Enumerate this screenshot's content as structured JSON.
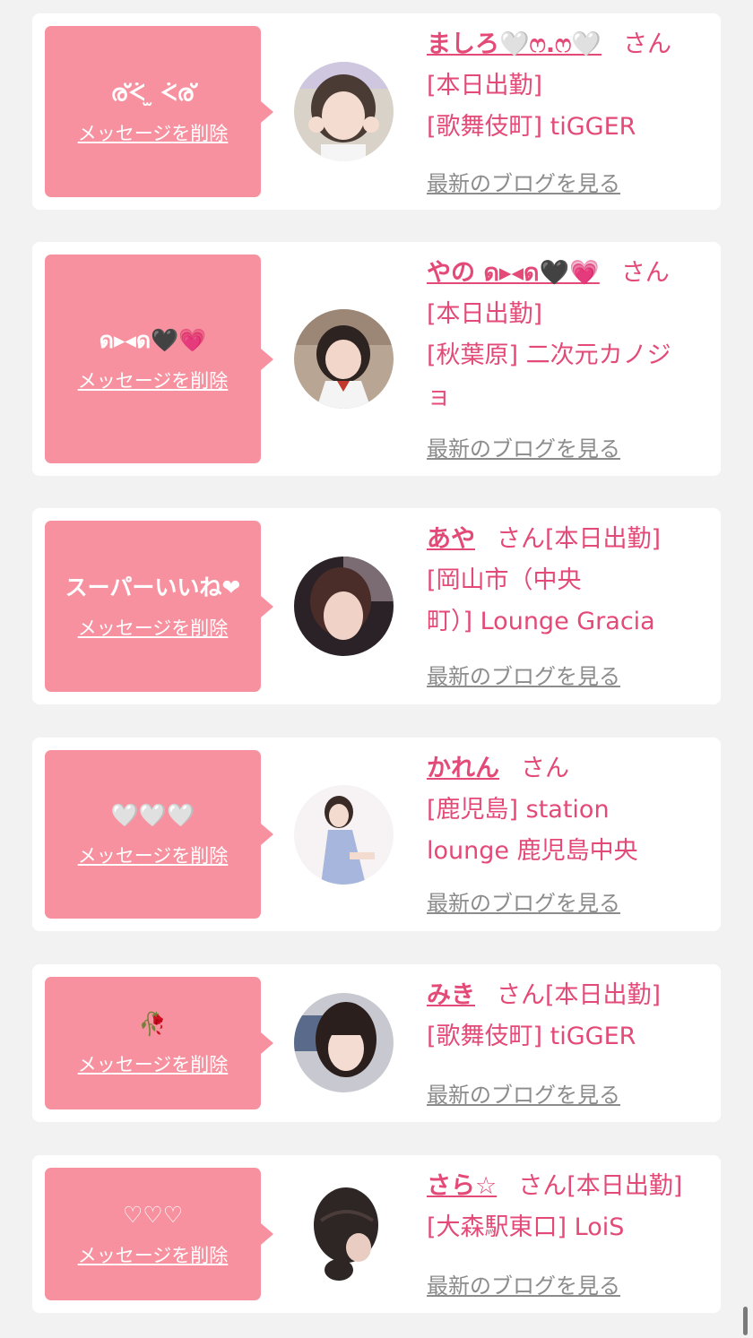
{
  "items": [
    {
      "message": "ര്ᢵ ̫ ᢵര്",
      "delete_label": "メッセージを削除",
      "name": "ましろ🤍ෆ.ෆ🤍",
      "san": "さん",
      "lines": [
        "[本日出勤]",
        "[歌舞伎町] tiGGER"
      ],
      "blog_label": "最新のブログを見る",
      "avatar": "avatar-1"
    },
    {
      "message": "ด▸◂ด🖤💗",
      "delete_label": "メッセージを削除",
      "name": "やの ด▸◂ด🖤💗",
      "san": "さん",
      "lines": [
        "[本日出勤]",
        "[秋葉原] 二次元カノジ",
        "ョ"
      ],
      "blog_label": "最新のブログを見る",
      "avatar": "avatar-2"
    },
    {
      "message": "スーパーいいね❤",
      "delete_label": "メッセージを削除",
      "name": "あや",
      "san": "さん[本日出勤]",
      "lines": [
        "[岡山市（中央",
        "町）] Lounge Gracia"
      ],
      "blog_label": "最新のブログを見る",
      "avatar": "avatar-3"
    },
    {
      "message": "🤍🤍🤍",
      "delete_label": "メッセージを削除",
      "name": "かれん",
      "san": "さん",
      "lines": [
        "[鹿児島] station",
        "lounge 鹿児島中央"
      ],
      "blog_label": "最新のブログを見る",
      "avatar": "avatar-4"
    },
    {
      "message": "🥀",
      "delete_label": "メッセージを削除",
      "name": "みき",
      "san": "さん[本日出勤]",
      "lines": [
        "[歌舞伎町] tiGGER"
      ],
      "blog_label": "最新のブログを見る",
      "avatar": "avatar-5"
    },
    {
      "message": "♡♡♡",
      "delete_label": "メッセージを削除",
      "name": "さら☆",
      "san": "さん[本日出勤]",
      "lines": [
        "[大森駅東口] LoiS"
      ],
      "blog_label": "最新のブログを見る",
      "avatar": "avatar-6"
    }
  ],
  "colors": {
    "bubble": "#f8919f",
    "name": "#e34a77",
    "blog_link": "#8c8c8c",
    "background": "#f2f2f2"
  }
}
